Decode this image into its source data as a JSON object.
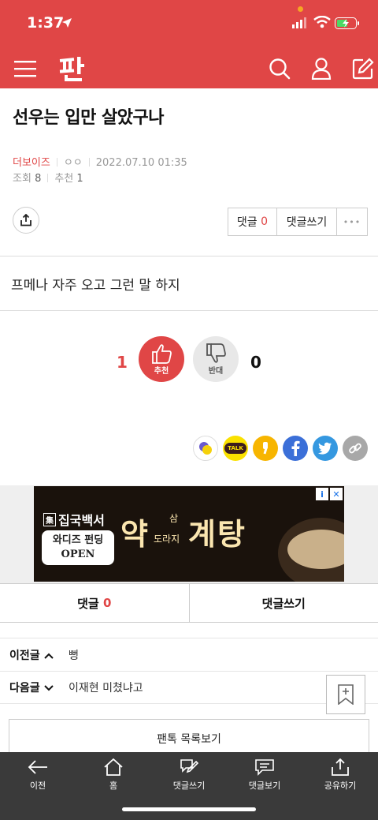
{
  "status": {
    "time": "1:37"
  },
  "header": {
    "logo_text": "판"
  },
  "post": {
    "title": "선우는 입만 살았구나",
    "author": "더보이즈",
    "author_sub": "ㅇㅇ",
    "datetime": "2022.07.10 01:35",
    "views_label": "조회",
    "views": "8",
    "recommend_label": "추천",
    "recommend": "1",
    "body": "프메나 자주 오고 그런 말 하지"
  },
  "actions": {
    "comment_label": "댓글",
    "comment_count": "0",
    "write_comment_label": "댓글쓰기",
    "more_label": "•••"
  },
  "votes": {
    "up_count": "1",
    "up_label": "추천",
    "down_label": "반대",
    "down_count": "0"
  },
  "share": {
    "kakao_talk": "TALK"
  },
  "ad": {
    "brand": "집국백서",
    "badge_line1": "와디즈 펀딩",
    "badge_line2": "OPEN",
    "big1": "약",
    "small1": "삼",
    "small2": "도라지",
    "big2": "계탕",
    "info": "i",
    "close": "✕"
  },
  "comment_tabs": {
    "comments_label": "댓글",
    "comments_count": "0",
    "write_label": "댓글쓰기"
  },
  "prev_next": {
    "prev_label": "이전글",
    "prev_title": "뻥",
    "next_label": "다음글",
    "next_title": "이재현 미쳤냐고"
  },
  "list_button": "팬톡 목록보기",
  "bottom_nav": [
    {
      "label": "이전",
      "icon": "back-arrow-icon"
    },
    {
      "label": "홈",
      "icon": "home-icon"
    },
    {
      "label": "댓글쓰기",
      "icon": "write-comment-icon"
    },
    {
      "label": "댓글보기",
      "icon": "view-comments-icon"
    },
    {
      "label": "공유하기",
      "icon": "share-icon"
    }
  ],
  "colors": {
    "brand_red": "#e04646",
    "bottom_bar": "#3a3a3a"
  }
}
